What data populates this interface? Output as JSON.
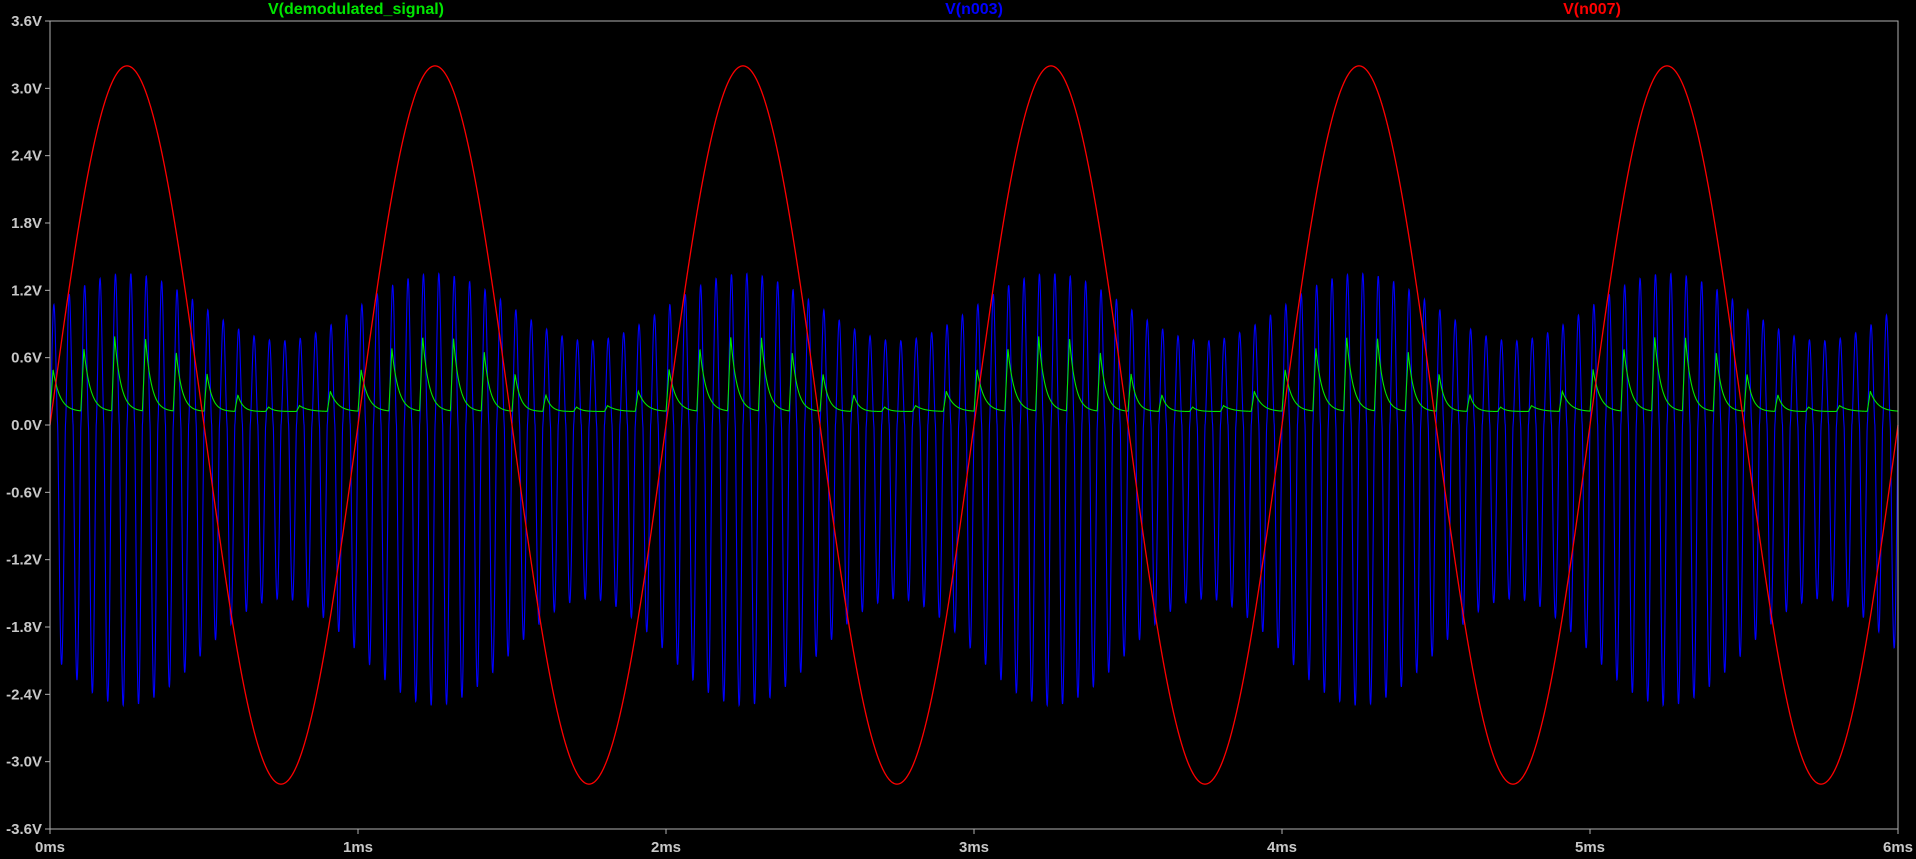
{
  "chart_data": {
    "type": "line",
    "background": "#000000",
    "axis_color": "#b0b0b0",
    "tick_label_color": "#c8c8c8",
    "x": {
      "unit": "ms",
      "range": [
        0,
        6
      ],
      "ticks": [
        0,
        1,
        2,
        3,
        4,
        5,
        6
      ],
      "tick_labels": [
        "0ms",
        "1ms",
        "2ms",
        "3ms",
        "4ms",
        "5ms",
        "6ms"
      ]
    },
    "y": {
      "unit": "V",
      "range": [
        -3.6,
        3.6
      ],
      "ticks": [
        3.6,
        3.0,
        2.4,
        1.8,
        1.2,
        0.6,
        0.0,
        -0.6,
        -1.2,
        -1.8,
        -2.4,
        -3.0,
        -3.6
      ],
      "tick_labels": [
        "3.6V",
        "3.0V",
        "2.4V",
        "1.8V",
        "1.2V",
        "0.6V",
        "0.0V",
        "-0.6V",
        "-1.2V",
        "-1.8V",
        "-2.4V",
        "-3.0V",
        "-3.6V"
      ]
    },
    "series": [
      {
        "name": "V(demodulated_signal)",
        "color": "#00e600",
        "kind": "peak-detector ripple following the modulation envelope",
        "carrier_period_ms": 0.1,
        "envelope_period_ms": 1.0,
        "baseline_v": 0.12,
        "peak_min_v": 0.15,
        "peak_max_v": 0.8
      },
      {
        "name": "V(n003)",
        "color": "#0000ff",
        "kind": "amplitude-modulated carrier",
        "carrier_period_ms": 0.05,
        "envelope_period_ms": 1.0,
        "positive_peak_min_v": 0.75,
        "positive_peak_max_v": 1.35,
        "negative_peak_min_v": -2.5,
        "negative_peak_max_v": -1.55
      },
      {
        "name": "V(n007)",
        "color": "#ff0000",
        "kind": "sine",
        "amplitude_v": 3.2,
        "period_ms": 1.0,
        "phase_ms": 0.0,
        "first_peak_ms": 0.25
      }
    ]
  }
}
